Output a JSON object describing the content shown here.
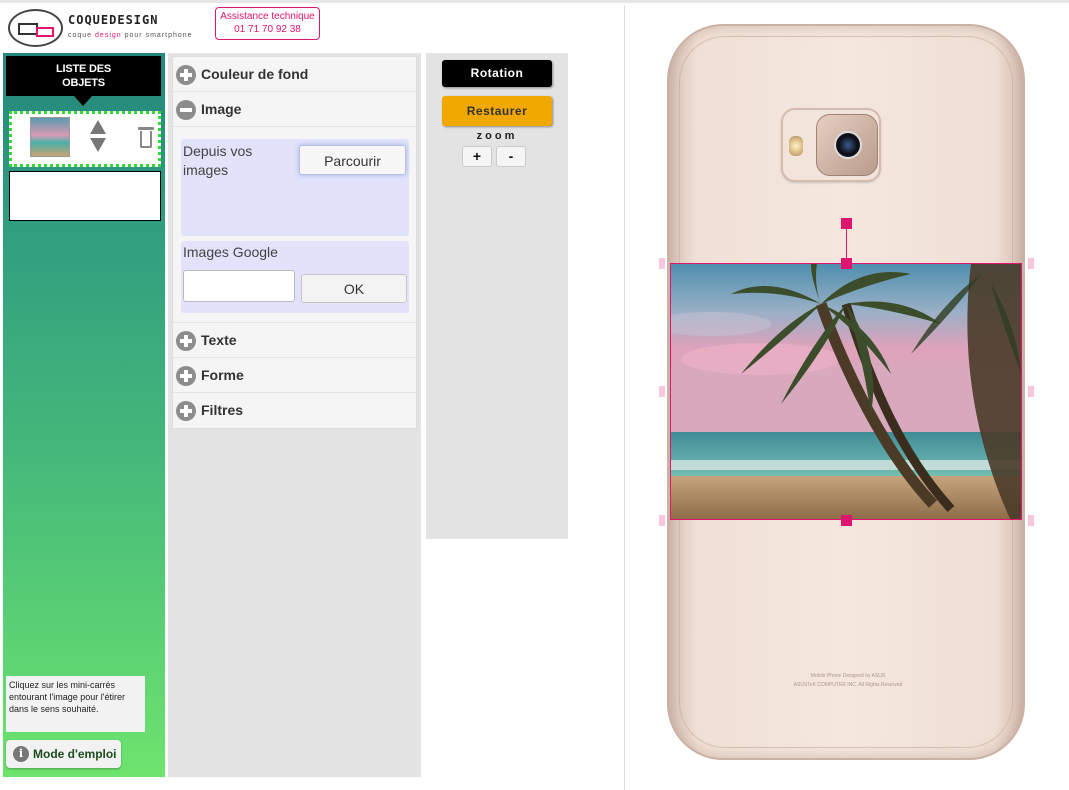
{
  "header": {
    "logo_name": "COQUEDESIGN",
    "logo_tag_prefix": "coque ",
    "logo_tag_accent": "design",
    "logo_tag_suffix": " pour smartphone",
    "assist_line1": "Assistance technique",
    "assist_line2": "01 71 70 92 38"
  },
  "left_panel": {
    "list_title_line1": "LISTE DES",
    "list_title_line2": "OBJETS",
    "hint": "Cliquez sur les mini-carrés entourant l'image pour l'étirer dans le sens souhaité.",
    "mode_label": "Mode d'emploi"
  },
  "accordion": {
    "couleur_label": "Couleur de fond",
    "image_label": "Image",
    "upload_label": "Depuis vos images",
    "browse_label": "Parcourir",
    "google_label": "Images Google",
    "google_placeholder": "",
    "ok_label": "OK",
    "texte_label": "Texte",
    "forme_label": "Forme",
    "filtres_label": "Filtres"
  },
  "controls": {
    "rotation_label": "Rotation",
    "restore_label": "Restaurer",
    "zoom_label": "zoom",
    "zoom_in": "+",
    "zoom_out": "-"
  },
  "phone": {
    "text_line1": "Mobile Phone Designed by ASUS",
    "text_line2": "ASUSTeK COMPUTER INC. All Rights Reserved"
  },
  "colors": {
    "accent": "#e0156f",
    "rotation_bg": "#000000",
    "restore_bg": "#f0a800",
    "selection_border": "#33dd33"
  }
}
